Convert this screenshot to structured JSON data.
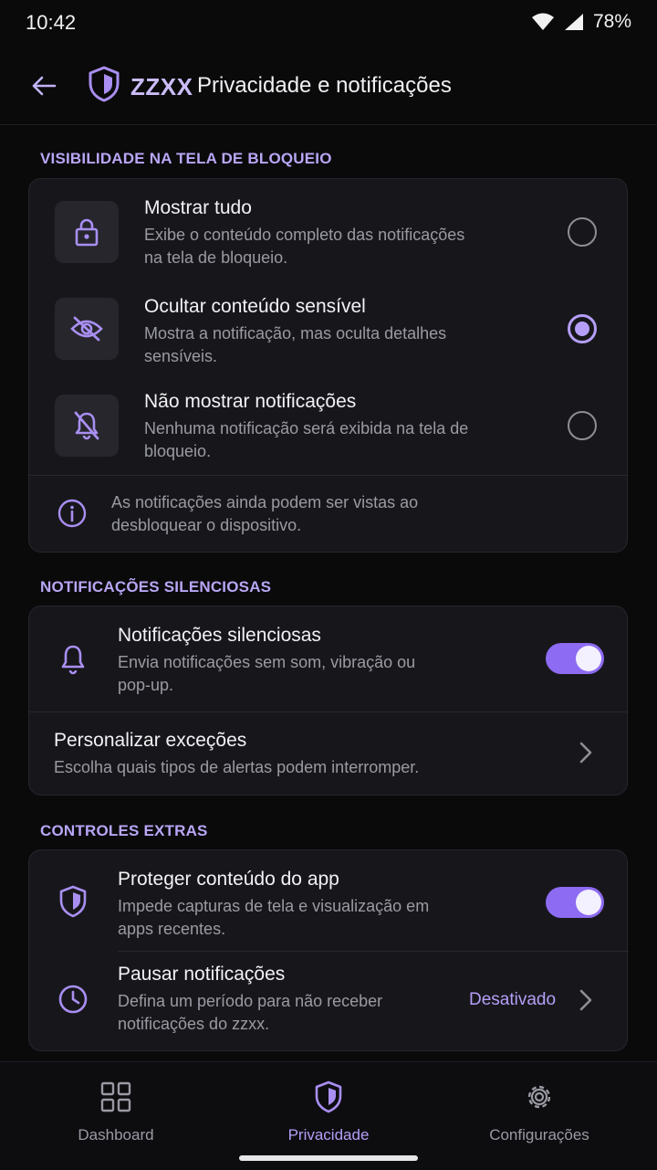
{
  "status_bar": {
    "time": "10:42",
    "battery": "78%"
  },
  "header": {
    "brand": "ZZXX",
    "title": "Privacidade e notificações",
    "back_icon": "arrow-left-icon",
    "brand_icon": "shield-icon"
  },
  "lock_screen": {
    "section_label": "VISIBILIDADE NA TELA DE BLOQUEIO",
    "options": [
      {
        "title": "Mostrar tudo",
        "subtitle": "Exibe o conteúdo completo das notificações na tela de bloqueio.",
        "icon": "lock-icon",
        "selected": false
      },
      {
        "title": "Ocultar conteúdo sensível",
        "subtitle": "Mostra a notificação, mas oculta detalhes sensíveis.",
        "icon": "eye-off-icon",
        "selected": true
      },
      {
        "title": "Não mostrar notificações",
        "subtitle": "Nenhuma notificação será exibida na tela de bloqueio.",
        "icon": "bell-off-icon",
        "selected": false
      }
    ],
    "info": "As notificações ainda podem ser vistas ao desbloquear o dispositivo."
  },
  "silent": {
    "section_label": "NOTIFICAÇÕES SILENCIOSAS",
    "toggle_title": "Notificações silenciosas",
    "toggle_subtitle": "Envia notificações sem som, vibração ou pop-up.",
    "toggle_on": true,
    "exceptions_title": "Personalizar exceções",
    "exceptions_subtitle": "Escolha quais tipos de alertas podem interromper."
  },
  "extras": {
    "section_label": "CONTROLES EXTRAS",
    "protect_title": "Proteger conteúdo do app",
    "protect_subtitle": "Impede capturas de tela e visualização em apps recentes.",
    "protect_on": true,
    "pause_title": "Pausar notificações",
    "pause_subtitle": "Defina um período para não receber notificações do zzxx.",
    "pause_value": "Desativado"
  },
  "bottom_nav": [
    {
      "label": "Dashboard",
      "icon": "grid-icon",
      "active": false
    },
    {
      "label": "Privacidade",
      "icon": "shield-icon",
      "active": true
    },
    {
      "label": "Configurações",
      "icon": "gear-icon",
      "active": false
    }
  ],
  "colors": {
    "accent": "#b59ef7",
    "toggle": "#8d6bf2",
    "background": "#0a0a0b",
    "card": "#17171b"
  }
}
